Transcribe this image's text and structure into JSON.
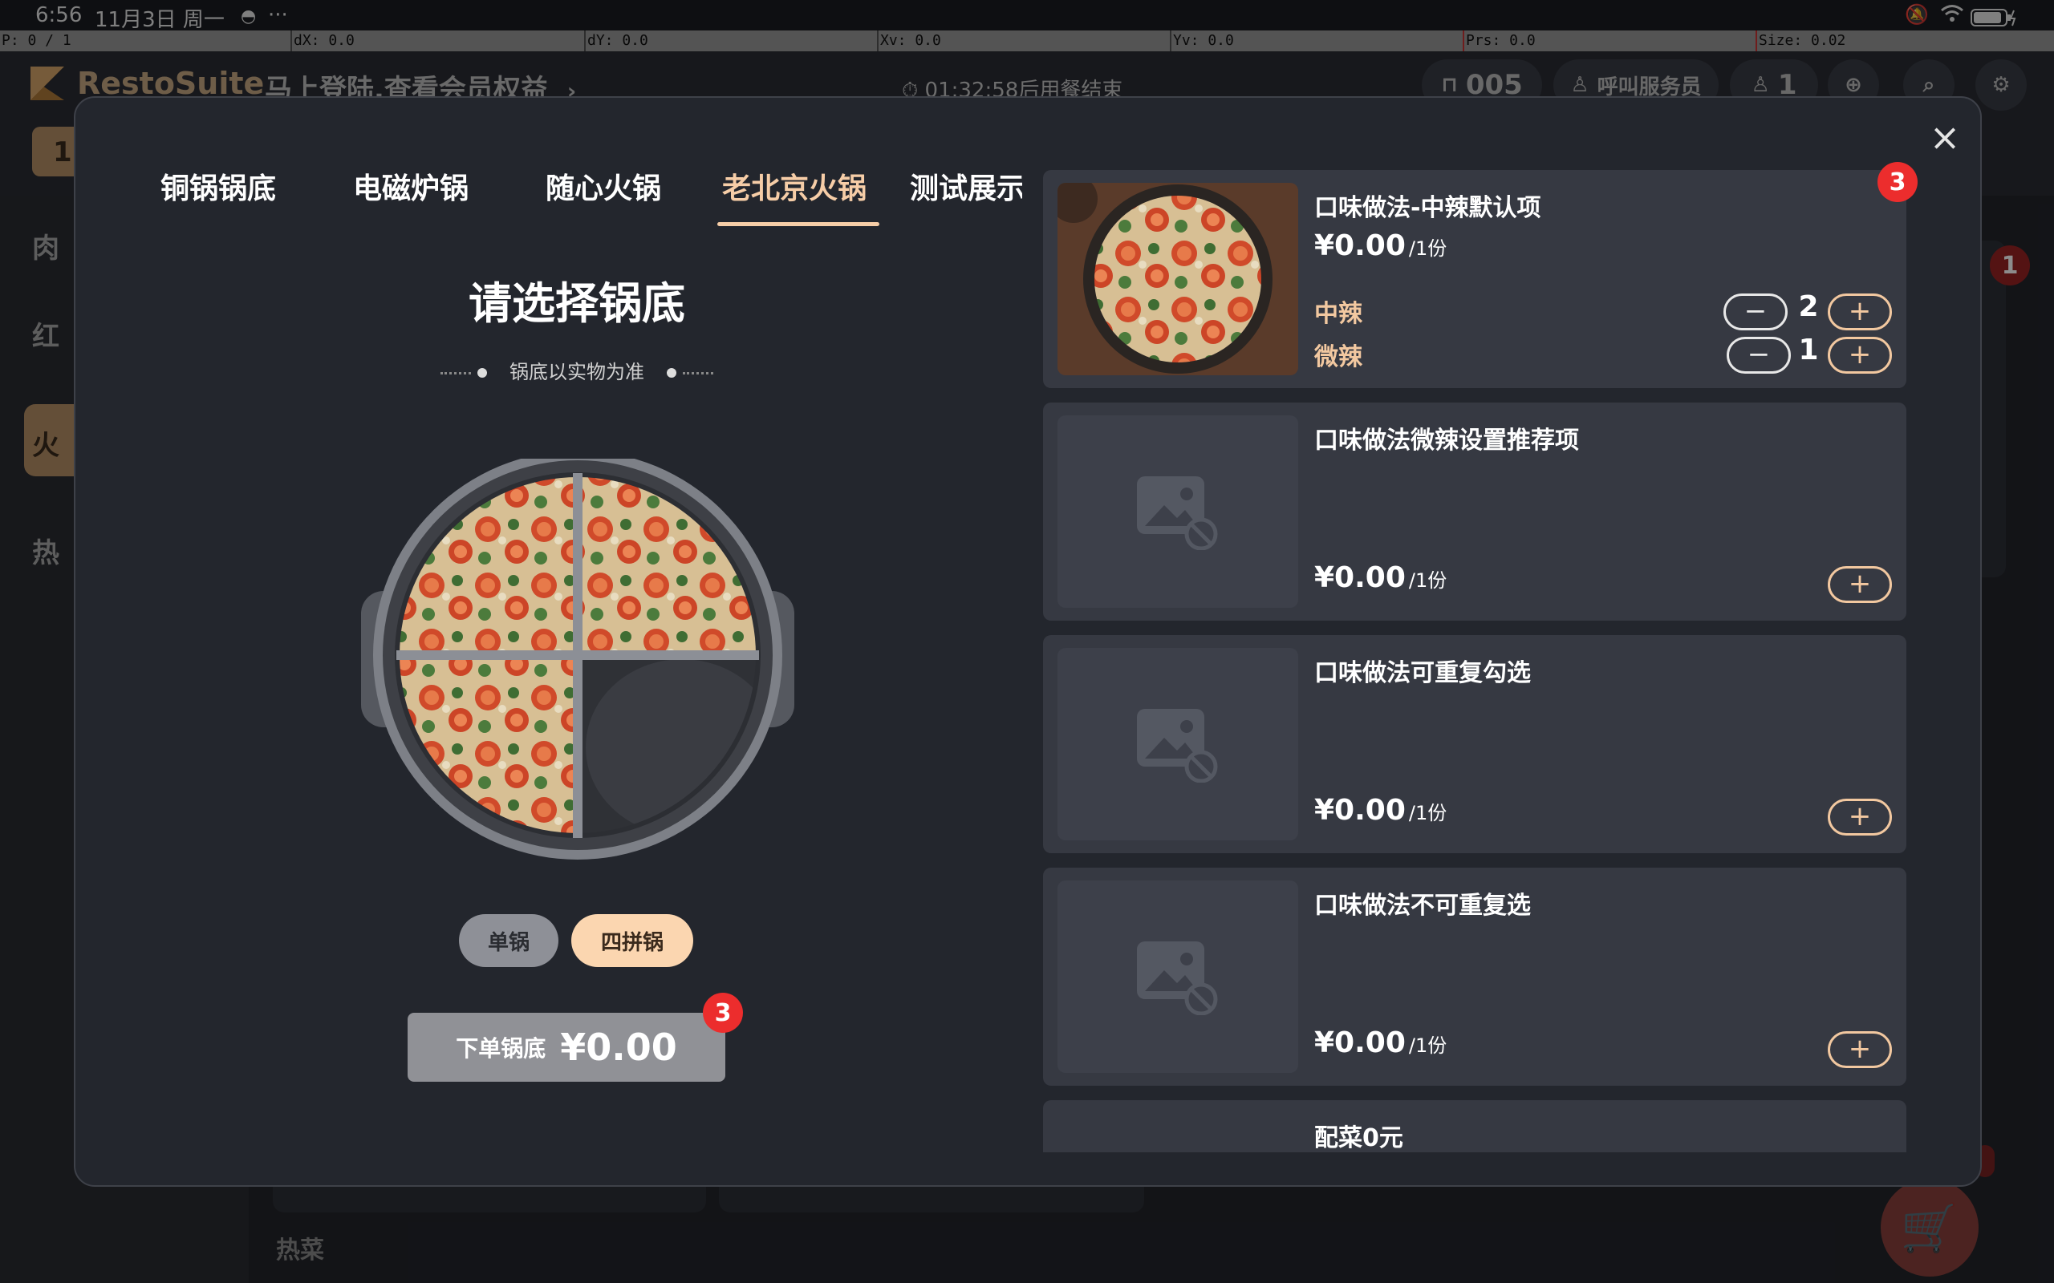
{
  "status": {
    "time": "6:56",
    "date": "11月3日 周一",
    "more": "···"
  },
  "debug": {
    "p": "P: 0 / 1",
    "dx": "dX: 0.0",
    "dy": "dY: 0.0",
    "xv": "Xv: 0.0",
    "yv": "Yv: 0.0",
    "prs": "Prs: 0.0",
    "size": "Size: 0.02"
  },
  "bg": {
    "brand": "RestoSuite",
    "login_prompt": "马上登陆,查看会员权益",
    "chevron": "›",
    "timer": "01:32:58后用餐结束",
    "table_no": "005",
    "call_waiter": "呼叫服务员",
    "guests": "1",
    "left_chip": "1",
    "side_categories": [
      "肉",
      "红",
      "火",
      "热"
    ],
    "hot_label": "热菜",
    "right_badge": "1"
  },
  "modal": {
    "tabs": [
      "铜锅锅底",
      "电磁炉锅",
      "随心火锅",
      "老北京火锅",
      "测试展示"
    ],
    "selected_tab": 3,
    "title": "请选择锅底",
    "subtitle": "锅底以实物为准",
    "pot_types": [
      "单锅",
      "四拼锅"
    ],
    "selected_pot_type": "四拼锅",
    "order": {
      "label": "下单锅底",
      "amount": "¥0.00",
      "badge": "3"
    },
    "close": "×",
    "items": [
      {
        "name": "口味做法-中辣默认项",
        "price": "¥0.00",
        "unit": "/1份",
        "badge": "3",
        "options": [
          {
            "label": "中辣",
            "qty": "2"
          },
          {
            "label": "微辣",
            "qty": "1"
          }
        ]
      },
      {
        "name": "口味做法微辣设置推荐项",
        "price": "¥0.00",
        "unit": "/1份"
      },
      {
        "name": "口味做法可重复勾选",
        "price": "¥0.00",
        "unit": "/1份"
      },
      {
        "name": "口味做法不可重复选",
        "price": "¥0.00",
        "unit": "/1份"
      },
      {
        "name": "配菜0元"
      }
    ],
    "plus": "+",
    "minus": "−"
  },
  "colors": {
    "accent": "#f6cda7",
    "badge": "#ec2d2d",
    "card": "#363942",
    "modal": "#23262d"
  }
}
